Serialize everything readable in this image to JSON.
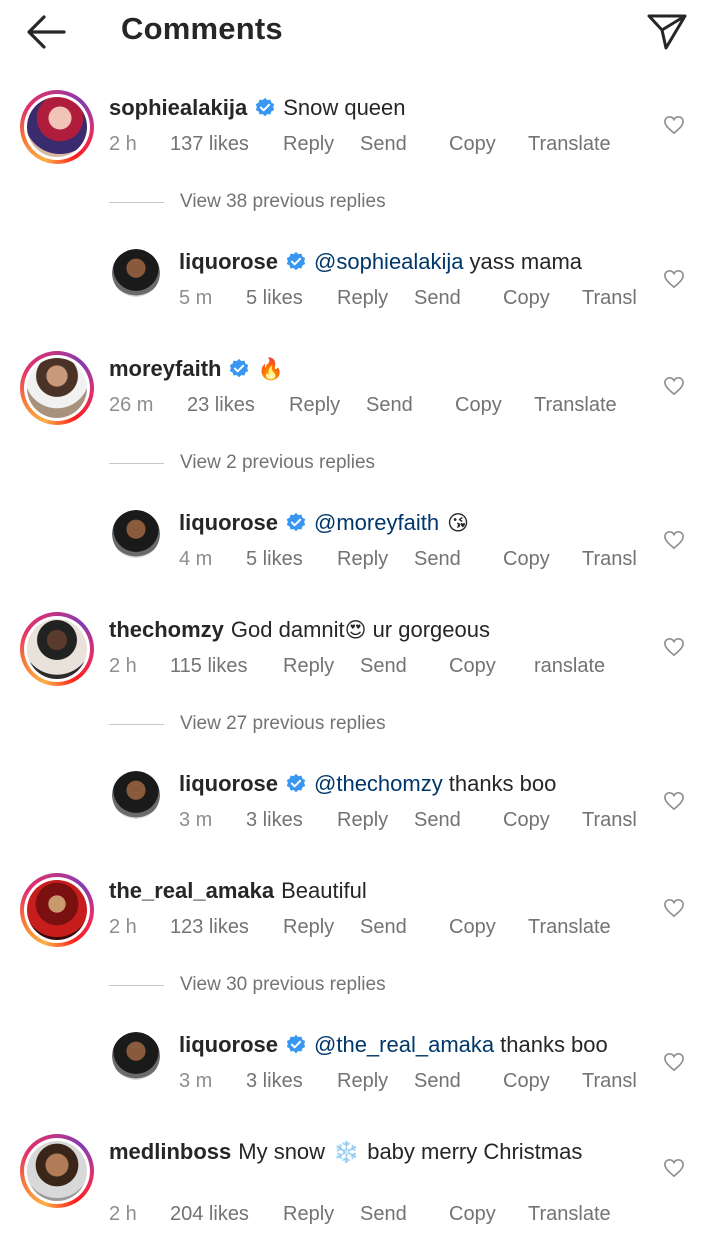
{
  "header": {
    "title": "Comments",
    "back_icon": "arrow-left-icon",
    "share_icon": "paper-plane-icon"
  },
  "actions": {
    "reply": "Reply",
    "send": "Send",
    "copy": "Copy",
    "translate": "Translate",
    "translate_truncated": "Transl",
    "translate_thechomzy": "ranslate"
  },
  "threads": [
    {
      "comment": {
        "username": "sophiealakija",
        "verified": true,
        "text": "Snow queen",
        "time": "2 h",
        "likes": "137 likes"
      },
      "view_replies": "View 38 previous replies",
      "reply": {
        "username": "liquorose",
        "verified": true,
        "mention": "@sophiealakija",
        "text": "yass mama",
        "time": "5 m",
        "likes": "5 likes"
      }
    },
    {
      "comment": {
        "username": "moreyfaith",
        "verified": true,
        "text": "",
        "emoji": "🔥",
        "time": "26 m",
        "likes": "23 likes"
      },
      "view_replies": "View 2 previous replies",
      "reply": {
        "username": "liquorose",
        "verified": true,
        "mention": "@moreyfaith",
        "text": "",
        "emoji": "😘",
        "time": "4 m",
        "likes": "5 likes"
      }
    },
    {
      "comment": {
        "username": "thechomzy",
        "verified": false,
        "text": "God damnit",
        "emoji": "😍",
        "text_after": "ur gorgeous",
        "time": "2 h",
        "likes": "115 likes"
      },
      "view_replies": "View 27 previous replies",
      "reply": {
        "username": "liquorose",
        "verified": true,
        "mention": "@thechomzy",
        "text": "thanks boo",
        "time": "3 m",
        "likes": "3 likes"
      }
    },
    {
      "comment": {
        "username": "the_real_amaka",
        "verified": false,
        "text": "Beautiful",
        "time": "2 h",
        "likes": "123 likes"
      },
      "view_replies": "View 30 previous replies",
      "reply": {
        "username": "liquorose",
        "verified": true,
        "mention": "@the_real_amaka",
        "text": "thanks boo",
        "time": "3 m",
        "likes": "3 likes"
      }
    },
    {
      "comment": {
        "username": "medlinboss",
        "verified": false,
        "text": "My snow",
        "emoji": "❄️",
        "text_after": "baby merry Christmas",
        "time": "2 h",
        "likes": "204 likes"
      }
    }
  ],
  "colors": {
    "text": "#262626",
    "secondary": "#8e8e8e",
    "mention": "#00376b",
    "verified": "#3897f0"
  }
}
